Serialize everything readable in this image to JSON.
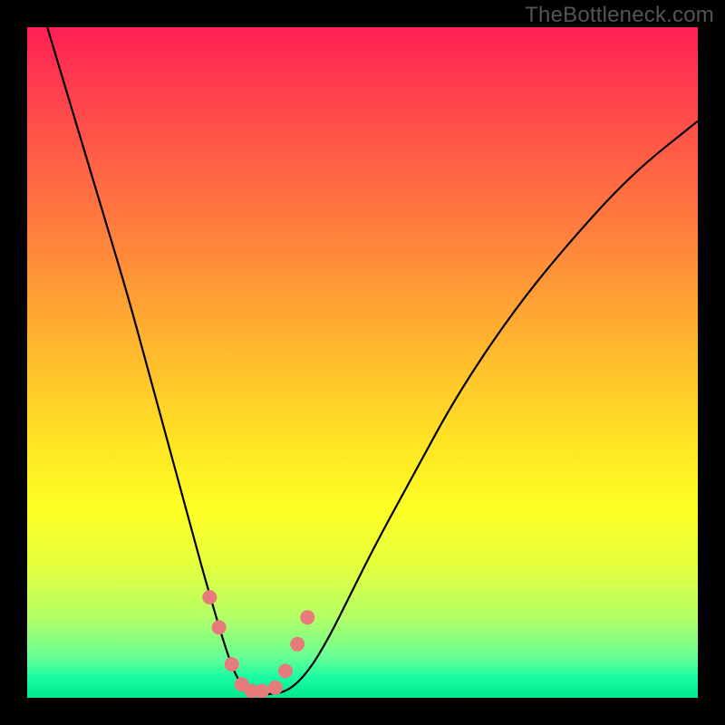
{
  "watermark": {
    "text": "TheBottleneck.com"
  },
  "chart_data": {
    "type": "line",
    "title": "",
    "xlabel": "",
    "ylabel": "",
    "xlim": [
      0,
      100
    ],
    "ylim": [
      0,
      100
    ],
    "grid": false,
    "legend": false,
    "annotations": [],
    "series": [
      {
        "name": "bottleneck-curve",
        "x": [
          3,
          6,
          9,
          12,
          15,
          18,
          21,
          24,
          27,
          30,
          31.5,
          33,
          34.5,
          36,
          39,
          42,
          45,
          48,
          52,
          58,
          64,
          72,
          80,
          90,
          100
        ],
        "y": [
          100,
          90,
          80,
          70,
          60,
          49,
          38,
          27,
          16,
          6,
          2.5,
          1,
          0.5,
          0.5,
          1,
          4,
          9,
          15,
          23,
          34,
          45,
          57,
          67,
          78,
          86
        ]
      },
      {
        "name": "data-points",
        "type": "scatter",
        "x": [
          27.2,
          28.6,
          30.5,
          32,
          33.5,
          35,
          37,
          38.5,
          40.3,
          41.8
        ],
        "y": [
          15,
          10.5,
          5,
          2,
          1,
          1,
          1.5,
          4,
          8,
          12
        ]
      }
    ],
    "background_gradient": {
      "stops": [
        {
          "pos": 0,
          "color": "#ff1f55"
        },
        {
          "pos": 50,
          "color": "#ffb82e"
        },
        {
          "pos": 75,
          "color": "#fdff25"
        },
        {
          "pos": 100,
          "color": "#00e88b"
        }
      ]
    }
  }
}
